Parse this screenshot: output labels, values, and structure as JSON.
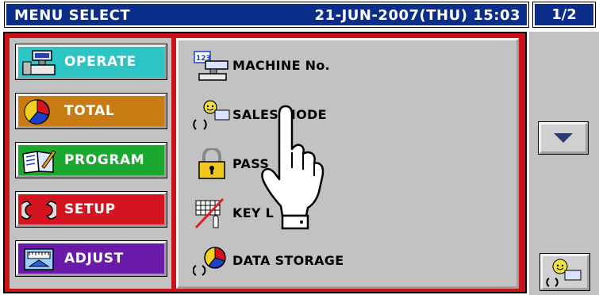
{
  "title": {
    "text": "MENU SELECT",
    "datetime": "21-JUN-2007(THU) 15:03",
    "page": "1/2"
  },
  "nav": [
    {
      "label": "OPERATE",
      "icon": "scale-icon",
      "color": "#2ec4c4"
    },
    {
      "label": "TOTAL",
      "icon": "pie-chart-icon",
      "color": "#c77b12"
    },
    {
      "label": "PROGRAM",
      "icon": "book-pencil-icon",
      "color": "#1aa82e"
    },
    {
      "label": "SETUP",
      "icon": "wrench-icon",
      "color": "#d4141e"
    },
    {
      "label": "ADJUST",
      "icon": "calibration-icon",
      "color": "#6a1aa8"
    }
  ],
  "menu": [
    {
      "label": "MACHINE No.",
      "icon": "machine-number-icon"
    },
    {
      "label": "SALES MODE",
      "icon": "sales-mode-icon"
    },
    {
      "label": "PASS",
      "icon": "padlock-icon"
    },
    {
      "label": "KEY L",
      "icon": "key-lock-icon"
    },
    {
      "label": "DATA STORAGE",
      "icon": "data-storage-icon"
    }
  ],
  "side": {
    "scroll_icon": "down-arrow-icon",
    "help_icon": "operator-help-icon"
  },
  "colors": {
    "title_bg": "#0a2e8a",
    "frame": "#c8131a",
    "panel": "#c2c2c2"
  }
}
